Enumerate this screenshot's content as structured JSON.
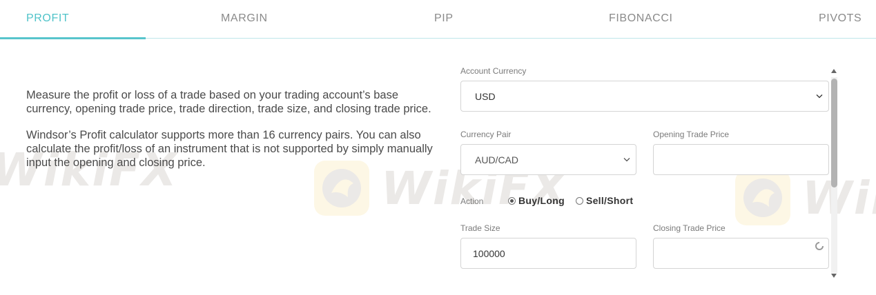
{
  "tabs": [
    {
      "label": "PROFIT",
      "active": true
    },
    {
      "label": "MARGIN",
      "active": false
    },
    {
      "label": "PIP",
      "active": false
    },
    {
      "label": "FIBONACCI",
      "active": false
    },
    {
      "label": "PIVOTS",
      "active": false
    }
  ],
  "description": {
    "paragraph1": "Measure the profit or loss of a trade based on your trading account’s base currency, opening trade price, trade direction, trade size, and closing trade price.",
    "paragraph2": "Windsor’s Profit calculator supports more than 16 currency pairs. You can also calculate the profit/loss of an instrument that is not supported by simply manually input the opening and closing price."
  },
  "form": {
    "account_currency": {
      "label": "Account Currency",
      "value": "USD"
    },
    "currency_pair": {
      "label": "Currency Pair",
      "value": "AUD/CAD"
    },
    "opening_trade_price": {
      "label": "Opening Trade Price",
      "value": ""
    },
    "action": {
      "label": "Action",
      "options": [
        {
          "label": "Buy/Long",
          "checked": true
        },
        {
          "label": "Sell/Short",
          "checked": false
        }
      ]
    },
    "trade_size": {
      "label": "Trade Size",
      "value": "100000"
    },
    "closing_trade_price": {
      "label": "Closing Trade Price",
      "value": ""
    }
  },
  "watermark": {
    "text": "WikiFX"
  },
  "colors": {
    "accent": "#4fc3c9",
    "tab_inactive": "#8a8a8a",
    "border": "#d4d4d4"
  }
}
